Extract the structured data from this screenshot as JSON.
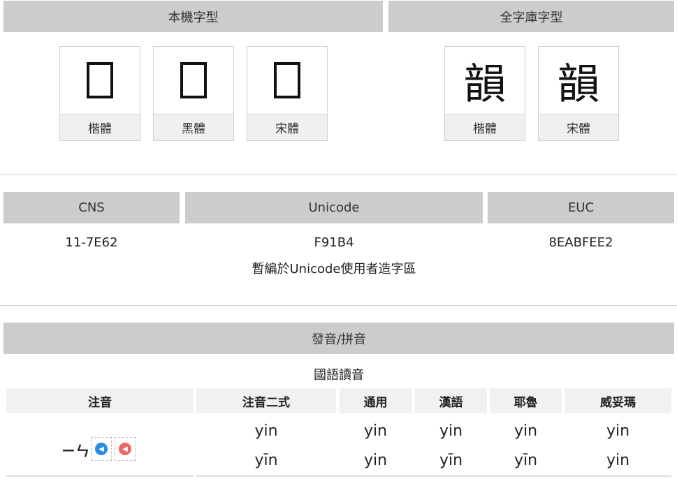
{
  "fonts": {
    "local_header": "本機字型",
    "full_header": "全字庫字型",
    "local_cards": [
      {
        "label": "楷體"
      },
      {
        "label": "黑體"
      },
      {
        "label": "宋體"
      }
    ],
    "full_cards": [
      {
        "glyph": "韻",
        "label": "楷體"
      },
      {
        "glyph": "韻",
        "label": "宋體"
      }
    ]
  },
  "codes": {
    "cns_header": "CNS",
    "unicode_header": "Unicode",
    "euc_header": "EUC",
    "cns_value": "11-7E62",
    "unicode_value": "F91B4",
    "unicode_note": "暫編於Unicode使用者造字區",
    "euc_value": "8EABFEE2"
  },
  "pronunciation": {
    "header": "發音/拼音",
    "subheader": "國語讀音",
    "columns": [
      "注音",
      "注音二式",
      "通用",
      "漢語",
      "耶魯",
      "威妥瑪"
    ],
    "zhuyin": "ㄧㄣ",
    "rows": [
      [
        "yin",
        "yin",
        "yin",
        "yin",
        "yin"
      ],
      [
        "yīn",
        "yin",
        "yīn",
        "yīn",
        "yin"
      ]
    ],
    "audio_icons": [
      "speaker-blue-icon",
      "speaker-red-icon"
    ],
    "colors": {
      "audio_blue": "#2a8de0",
      "audio_red": "#e86a6a"
    }
  }
}
